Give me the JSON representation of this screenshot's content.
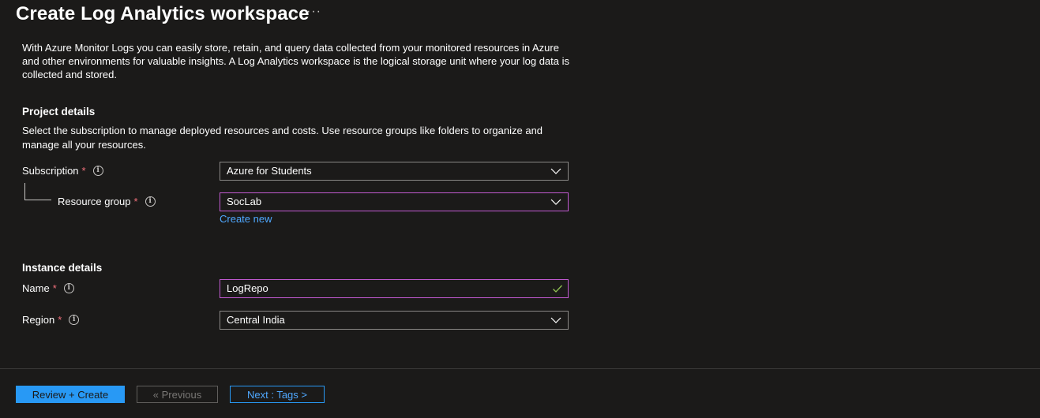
{
  "header": {
    "title": "Create Log Analytics workspace",
    "more_label": "···"
  },
  "intro": {
    "text": "With Azure Monitor Logs you can easily store, retain, and query data collected from your monitored resources in Azure and other environments for valuable insights. A Log Analytics workspace is the logical storage unit where your log data is collected and stored."
  },
  "project": {
    "heading": "Project details",
    "description": "Select the subscription to manage deployed resources and costs. Use resource groups like folders to organize and manage all your resources.",
    "subscription": {
      "label": "Subscription",
      "required": "*",
      "value": "Azure for Students"
    },
    "resource_group": {
      "label": "Resource group",
      "required": "*",
      "value": "SocLab",
      "create_new": "Create new"
    }
  },
  "instance": {
    "heading": "Instance details",
    "name": {
      "label": "Name",
      "required": "*",
      "value": "LogRepo"
    },
    "region": {
      "label": "Region",
      "required": "*",
      "value": "Central India"
    }
  },
  "footer": {
    "review_create": "Review + Create",
    "previous": "« Previous",
    "next": "Next : Tags >"
  },
  "icons": {
    "info": "info-icon",
    "chevron": "chevron-down-icon",
    "check": "checkmark-icon"
  },
  "colors": {
    "background": "#1b1a19",
    "accent": "#2899f5",
    "link": "#4fa8ff",
    "required": "#f1707b",
    "focus_border": "#c25ad1",
    "valid_check": "#92c353"
  }
}
